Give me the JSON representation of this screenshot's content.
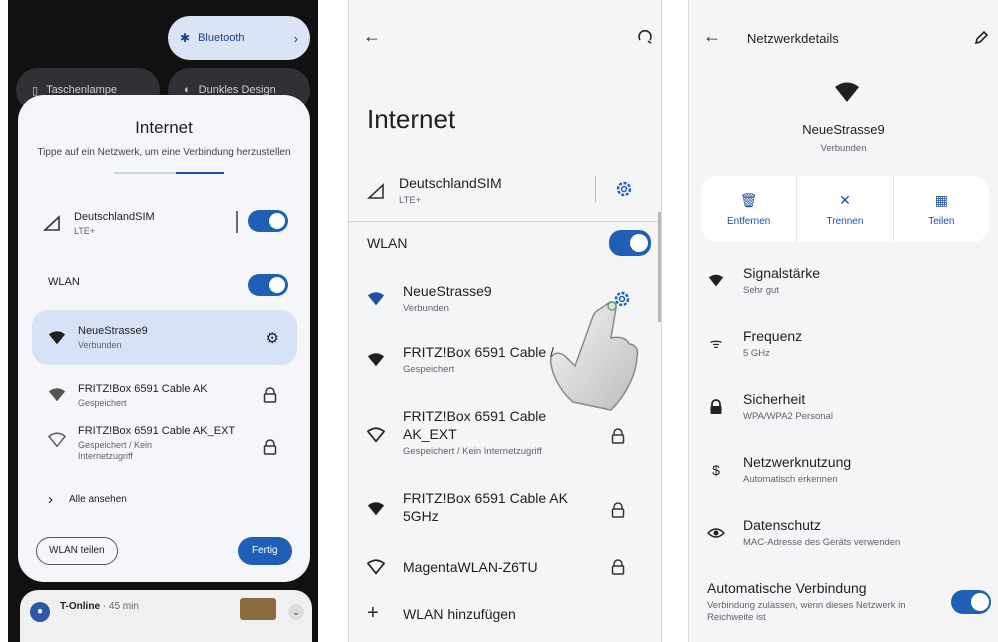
{
  "panel1": {
    "bluetooth_label": "Bluetooth",
    "flashlight_label": "Taschenlampe",
    "dark_label": "Dunkles Design",
    "dialog_title": "Internet",
    "dialog_subtitle": "Tippe auf ein Netzwerk, um eine Verbindung herzustellen",
    "sim_name": "DeutschlandSIM",
    "sim_type": "LTE+",
    "wlan_label": "WLAN",
    "networks": [
      {
        "name": "NeueStrasse9",
        "status": "Verbunden"
      },
      {
        "name": "FRITZ!Box 6591 Cable AK",
        "status": "Gespeichert"
      },
      {
        "name": "FRITZ!Box 6591 Cable AK_EXT",
        "status_line1": "Gespeichert / Kein",
        "status_line2": "Internetzugriff"
      }
    ],
    "see_all": "Alle ansehen",
    "share_button": "WLAN teilen",
    "done_button": "Fertig",
    "notification_title": "T-Online",
    "notification_time": "· 45 min"
  },
  "panel2": {
    "title": "Internet",
    "sim_name": "DeutschlandSIM",
    "sim_type": "LTE+",
    "wlan_label": "WLAN",
    "networks": [
      {
        "name": "NeueStrasse9",
        "status": "Verbunden"
      },
      {
        "name": "FRITZ!Box 6591 Cable /",
        "status": "Gespeichert"
      },
      {
        "name_line1": "FRITZ!Box 6591 Cable",
        "name_line2": "AK_EXT",
        "status": "Gespeichert / Kein Internetzugriff"
      },
      {
        "name_line1": "FRITZ!Box 6591 Cable AK",
        "name_line2": "5GHz"
      },
      {
        "name": "MagentaWLAN-Z6TU"
      }
    ],
    "add_wlan": "WLAN hinzufügen"
  },
  "panel3": {
    "header": "Netzwerkdetails",
    "network_name": "NeueStrasse9",
    "network_status": "Verbunden",
    "actions": [
      {
        "label": "Entfernen",
        "icon": "🗑"
      },
      {
        "label": "Trennen",
        "icon": "✕"
      },
      {
        "label": "Teilen",
        "icon": "▦"
      }
    ],
    "details": [
      {
        "label": "Signalstärke",
        "value": "Sehr gut"
      },
      {
        "label": "Frequenz",
        "value": "5 GHz"
      },
      {
        "label": "Sicherheit",
        "value": "WPA/WPA2 Personal"
      },
      {
        "label": "Netzwerknutzung",
        "value": "Automatisch erkennen"
      },
      {
        "label": "Datenschutz",
        "value": "MAC-Adresse des Geräts verwenden"
      }
    ],
    "auto_label": "Automatische Verbindung",
    "auto_desc": "Verbindung zulassen, wenn dieses Netzwerk in Reichweite ist"
  },
  "colors": {
    "accent": "#1f5fb5",
    "selected_bg": "#d8e2f6",
    "panel_bg": "#f4f5f7"
  }
}
